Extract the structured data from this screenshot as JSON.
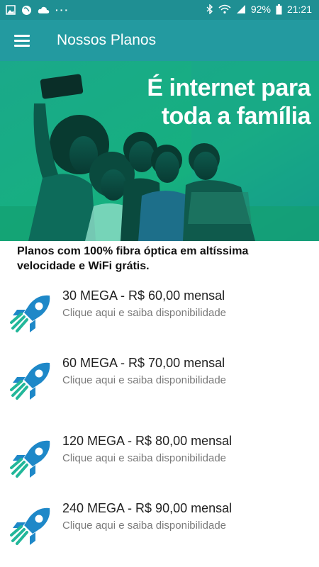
{
  "status_bar": {
    "battery": "92%",
    "time": "21:21",
    "left_icons": [
      "image-icon",
      "globe-icon",
      "cloud-icon",
      "more-dots-icon"
    ],
    "right_icons": [
      "bluetooth-icon",
      "wifi-icon",
      "signal-icon",
      "battery-icon"
    ]
  },
  "app_bar": {
    "title": "Nossos Planos",
    "color": "#239aa0"
  },
  "hero": {
    "line1": "É internet para",
    "line2": "toda a família"
  },
  "subtitle": {
    "line1": "Planos com 100% fibra óptica em altíssima",
    "line2": "velocidade e WiFi grátis."
  },
  "plans": [
    {
      "title": "30 MEGA - R$ 60,00 mensal",
      "subtitle": "Clique aqui e saiba disponibilidade"
    },
    {
      "title": "60 MEGA - R$ 70,00 mensal",
      "subtitle": "Clique aqui e saiba disponibilidade"
    },
    {
      "title": "120 MEGA - R$ 80,00 mensal",
      "subtitle": "Clique aqui e saiba disponibilidade"
    },
    {
      "title": "240 MEGA - R$ 90,00 mensal",
      "subtitle": "Clique aqui e saiba disponibilidade"
    }
  ],
  "colors": {
    "status_bar": "#1f8f93",
    "rocket_blue": "#1e88c8",
    "rocket_green": "#22b79a"
  }
}
